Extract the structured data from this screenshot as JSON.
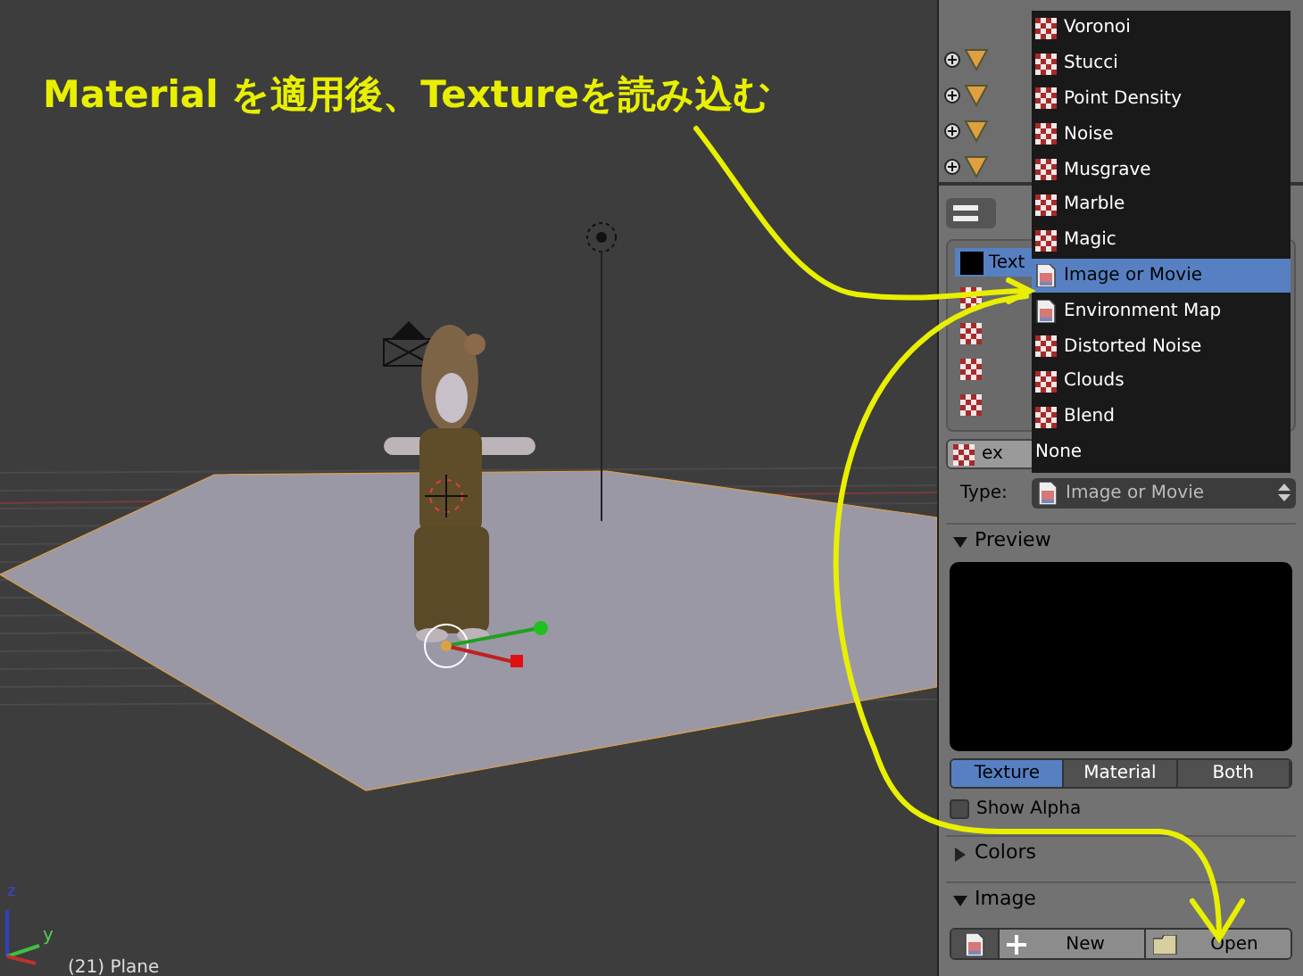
{
  "annotation": "Material を適用後、Textureを読み込む",
  "viewport": {
    "object_label": "(21) Plane",
    "axis_labels": [
      "z",
      "y"
    ]
  },
  "texture_menu": {
    "items": [
      {
        "label": "Voronoi",
        "kind": "checker",
        "selected": false
      },
      {
        "label": "Stucci",
        "kind": "checker",
        "selected": false
      },
      {
        "label": "Point Density",
        "kind": "checker",
        "selected": false
      },
      {
        "label": "Noise",
        "kind": "checker",
        "selected": false
      },
      {
        "label": "Musgrave",
        "kind": "checker",
        "selected": false
      },
      {
        "label": "Marble",
        "kind": "checker",
        "selected": false
      },
      {
        "label": "Magic",
        "kind": "checker",
        "selected": false
      },
      {
        "label": "Image or Movie",
        "kind": "image",
        "selected": true
      },
      {
        "label": "Environment Map",
        "kind": "image",
        "selected": false
      },
      {
        "label": "Distorted Noise",
        "kind": "checker",
        "selected": false
      },
      {
        "label": "Clouds",
        "kind": "checker",
        "selected": false
      },
      {
        "label": "Blend",
        "kind": "checker",
        "selected": false
      },
      {
        "label": "None",
        "kind": "none",
        "selected": false
      }
    ]
  },
  "texture_slots": [
    {
      "label": "Text",
      "kind": "black",
      "selected": true
    },
    {
      "kind": "checker",
      "selected": false
    },
    {
      "kind": "checker",
      "selected": false
    },
    {
      "kind": "checker",
      "selected": false
    },
    {
      "kind": "checker",
      "selected": false
    }
  ],
  "name_field": {
    "value": "ex"
  },
  "type_field": {
    "label": "Type:",
    "value": "Image or Movie"
  },
  "preview": {
    "title": "Preview",
    "expanded": true,
    "tabs": [
      {
        "label": "Texture",
        "selected": true
      },
      {
        "label": "Material",
        "selected": false
      },
      {
        "label": "Both",
        "selected": false
      }
    ],
    "show_alpha": {
      "label": "Show Alpha",
      "checked": false
    }
  },
  "colors": {
    "title": "Colors",
    "expanded": false
  },
  "image": {
    "title": "Image",
    "expanded": true,
    "buttons": [
      "New",
      "Open"
    ]
  }
}
